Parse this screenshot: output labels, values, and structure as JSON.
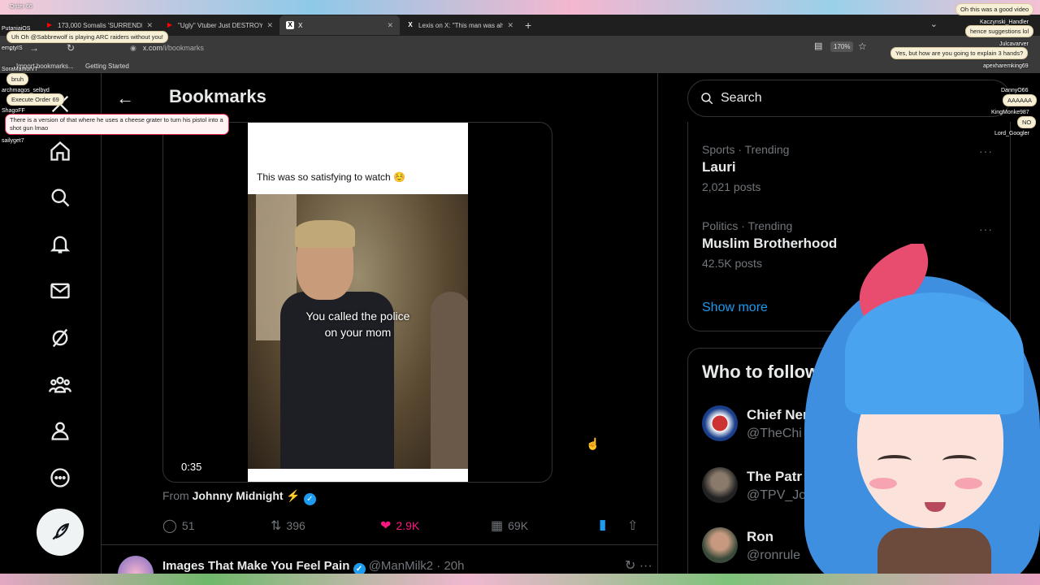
{
  "browser": {
    "tabs": [
      {
        "title": "173,000 Somalis 'SURRENDER t",
        "icon": "youtube-icon"
      },
      {
        "title": "\"Ugly\" Vtuber Just DESTROYED",
        "icon": "youtube-icon"
      },
      {
        "title": "X",
        "icon": "x-icon",
        "active": true
      },
      {
        "title": "Lexis on X: \"This man was ahea",
        "icon": "x-icon"
      }
    ],
    "new_tab": "+",
    "url_host": "x.com",
    "url_path": "/i/bookmarks",
    "zoom": "170%",
    "bookmarks": [
      {
        "label": "Import bookmarks..."
      },
      {
        "label": "Getting Started"
      }
    ]
  },
  "header": {
    "title": "Bookmarks"
  },
  "post": {
    "video_caption": "This was so satisfying to watch ☺️",
    "subtitle_line1": "You called the police",
    "subtitle_line2": "on your mom",
    "duration": "0:35",
    "from_prefix": "From",
    "from_name": "Johnny Midnight ⚡",
    "replies": "51",
    "reposts": "396",
    "likes": "2.9K",
    "views": "69K"
  },
  "next_post": {
    "name": "Images That Make You Feel Pain",
    "handle": "@ManMilk2 · 20h"
  },
  "search": {
    "placeholder": "Search"
  },
  "trends": [
    {
      "category": "Sports · Trending",
      "name": "Lauri",
      "count": "2,021 posts"
    },
    {
      "category": "Politics · Trending",
      "name": "Muslim Brotherhood",
      "count": "42.5K posts"
    }
  ],
  "show_more": "Show more",
  "who_to_follow": {
    "title": "Who to follow",
    "accounts": [
      {
        "name": "Chief Ner",
        "handle": "@TheChi"
      },
      {
        "name": "The Patr",
        "handle": "@TPV_Jo"
      },
      {
        "name": "Ron",
        "handle": "@ronrule"
      }
    ]
  },
  "chat_overlay": {
    "names": [
      "Order 66",
      "PutaniaiOS",
      "emptyIS",
      "SoraMamorvT",
      "archmagos_selbyd",
      "ShagoFF",
      "sailyget7",
      "Lord_Googler",
      "KingMonke987",
      "DannyO66",
      "apexharemking69",
      "Julcavarver",
      "Kaczynski_Handler"
    ],
    "messages": [
      {
        "text": "Uh Oh @Sabbrewolf is playing ARC raiders without you!"
      },
      {
        "text": "bruh"
      },
      {
        "text": "Execute Order 69"
      },
      {
        "text": "There is a version of that where he uses a cheese grater to turn his pistol into a shot gun lmao",
        "highlight": true
      },
      {
        "text": "Oh this was a good video"
      },
      {
        "text": "hence suggestions lol"
      },
      {
        "text": "Yes, but how are you going to explain 3 hands?"
      },
      {
        "text": "AAAAAA"
      },
      {
        "text": "NO"
      }
    ]
  },
  "colors": {
    "accent": "#1d9bf0",
    "like": "#f91880",
    "background": "#000000"
  }
}
